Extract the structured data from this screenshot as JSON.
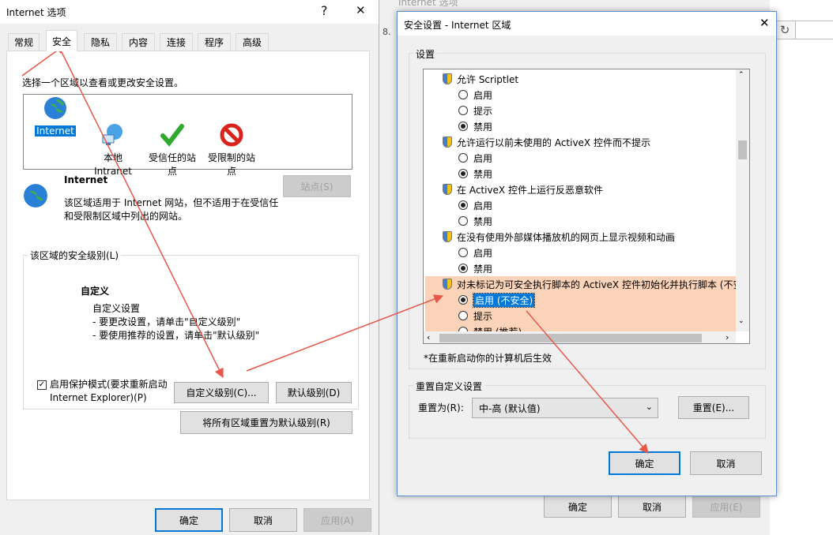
{
  "left_dialog": {
    "title": "Internet 选项",
    "help": "?",
    "close": "✕",
    "tabs": [
      "常规",
      "安全",
      "隐私",
      "内容",
      "连接",
      "程序",
      "高级"
    ],
    "instruction": "选择一个区域以查看或更改安全设置。",
    "zones": [
      {
        "label": "Internet",
        "icon": "globe-icon"
      },
      {
        "label": "本地\nIntranet",
        "icon": "intranet-icon"
      },
      {
        "label": "受信任的站\n点",
        "icon": "checkmark-icon"
      },
      {
        "label": "受限制的站\n点",
        "icon": "restricted-icon"
      }
    ],
    "zone_name": "Internet",
    "zone_desc": "该区域适用于 Internet 网站，但不适用于在受信任\n和受限制区域中列出的网站。",
    "sites_button": "站点(S)",
    "security_level_label": "该区域的安全级别(L)",
    "level_title": "自定义",
    "level_desc": "自定义设置\n- 要更改设置，请单击\"自定义级别\"\n- 要使用推荐的设置，请单击\"默认级别\"",
    "protected_mode": "启用保护模式(要求重新启动\nInternet Explorer)(P)",
    "custom_level_button": "自定义级别(C)...",
    "default_level_button": "默认级别(D)",
    "reset_all_button": "将所有区域重置为默认级别(R)",
    "ok": "确定",
    "cancel": "取消",
    "apply": "应用(A)"
  },
  "behind_dialog": {
    "title_fragment": "Internet 选项",
    "address_fragment": "8.",
    "ok": "确定",
    "cancel": "取消",
    "apply": "应用(E)"
  },
  "right_dialog": {
    "title": "安全设置 - Internet 区域",
    "close": "✕",
    "settings_label": "设置",
    "items": [
      {
        "type": "header",
        "text": "允许 Scriptlet"
      },
      {
        "type": "radio",
        "text": "启用",
        "checked": false
      },
      {
        "type": "radio",
        "text": "提示",
        "checked": false
      },
      {
        "type": "radio",
        "text": "禁用",
        "checked": true
      },
      {
        "type": "header",
        "text": "允许运行以前未使用的 ActiveX 控件而不提示"
      },
      {
        "type": "radio",
        "text": "启用",
        "checked": false
      },
      {
        "type": "radio",
        "text": "禁用",
        "checked": true
      },
      {
        "type": "header",
        "text": "在 ActiveX 控件上运行反恶意软件"
      },
      {
        "type": "radio",
        "text": "启用",
        "checked": true
      },
      {
        "type": "radio",
        "text": "禁用",
        "checked": false
      },
      {
        "type": "header",
        "text": "在没有使用外部媒体播放机的网页上显示视频和动画"
      },
      {
        "type": "radio",
        "text": "启用",
        "checked": false
      },
      {
        "type": "radio",
        "text": "禁用",
        "checked": true
      },
      {
        "type": "header",
        "text": "对未标记为可安全执行脚本的 ActiveX 控件初始化并执行脚本 (不安全)"
      },
      {
        "type": "radio",
        "text": "启用 (不安全)",
        "checked": true
      },
      {
        "type": "radio",
        "text": "提示",
        "checked": false
      },
      {
        "type": "radio",
        "text": "禁用 (推荐)",
        "checked": false
      }
    ],
    "restart_note": "*在重新启动你的计算机后生效",
    "reset_group_label": "重置自定义设置",
    "reset_to_label": "重置为(R):",
    "reset_to_value": "中-高 (默认值)",
    "reset_button": "重置(E)...",
    "ok": "确定",
    "cancel": "取消"
  },
  "colors": {
    "highlight_row": "#fbd3b9",
    "annotation": "#e8574a",
    "selection": "#0078d7"
  }
}
